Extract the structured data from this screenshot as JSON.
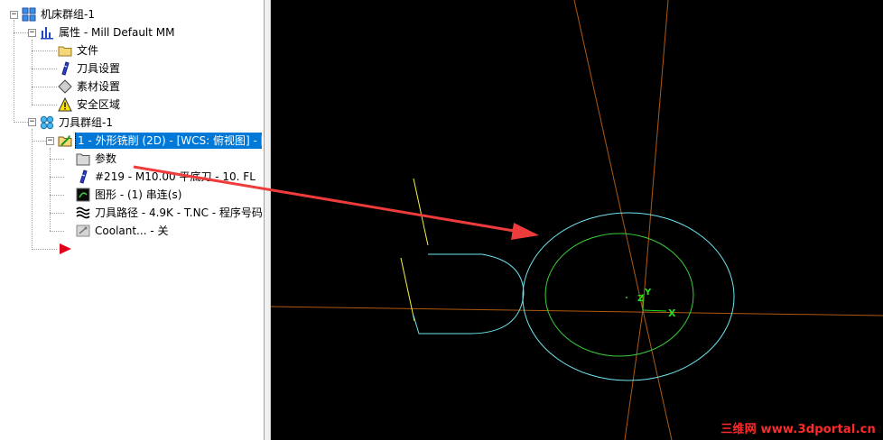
{
  "tree": {
    "machine_group": "机床群组-1",
    "properties": "属性 - Mill Default MM",
    "files": "文件",
    "tool_settings": "刀具设置",
    "stock_setup": "素材设置",
    "safety_zone": "安全区域",
    "toolpath_group": "刀具群组-1",
    "operation": "1 - 外形铣削 (2D) - [WCS: 俯视图] - [",
    "parameters": "参数",
    "tool": "#219 - M10.00 平底刀 -     10. FL",
    "geometry": "图形 - (1) 串连(s)",
    "toolpath": "刀具路径 - 4.9K - T.NC - 程序号码",
    "coolant": "Coolant... - 关"
  },
  "viewport": {
    "axis_x_label": "X",
    "axis_y_label": "Y",
    "axis_z_label": "Z",
    "colors": {
      "background": "#000000",
      "outer_circle": "#6fe3ef",
      "inner_circle": "#3ad13a",
      "profile": "#6fe3ef",
      "construction_line": "#b05a10",
      "yellow_line": "#f2f24a",
      "axis": "#22dd22"
    }
  },
  "annotation": {
    "arrow_color": "#ee3b3b"
  },
  "watermark": "三维网 www.3dportal.cn"
}
